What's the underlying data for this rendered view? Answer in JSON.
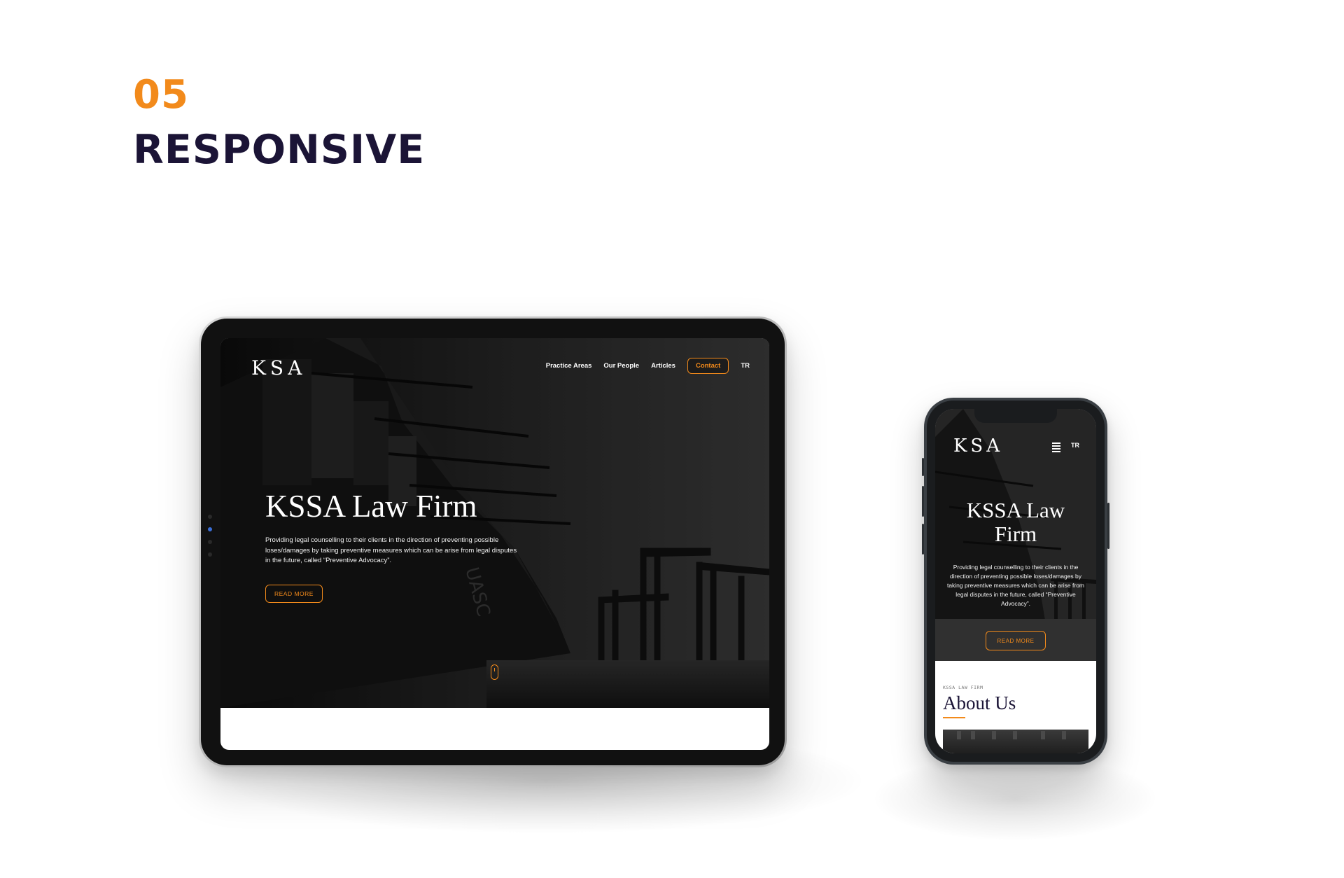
{
  "section": {
    "number": "05",
    "title": "RESPONSIVE"
  },
  "tablet": {
    "logo": "KSA",
    "nav": {
      "practice_areas": "Practice Areas",
      "our_people": "Our People",
      "articles": "Articles",
      "contact": "Contact",
      "language": "TR"
    },
    "hero": {
      "title": "KSSA Law Firm",
      "description": "Providing legal counselling to their clients in the direction of preventing possible loses/damages by taking preventive measures which can be arise from legal disputes in the future, called “Preventive Advocacy”.",
      "read_more": "READ MORE"
    }
  },
  "phone": {
    "logo": "KSA",
    "language": "TR",
    "hero": {
      "title": "KSSA Law Firm",
      "description": "Providing legal counselling to their clients in the direction of preventing possible loses/damages by taking preventive measures which can be arise from legal disputes in the future, called “Preventive Advocacy”.",
      "read_more": "READ MORE"
    },
    "about": {
      "eyebrow": "KSSA LAW FIRM",
      "heading": "About Us"
    }
  },
  "colors": {
    "accent": "#f28a1b",
    "heading": "#1b1436",
    "hero_bg": "#1a1a1a"
  }
}
